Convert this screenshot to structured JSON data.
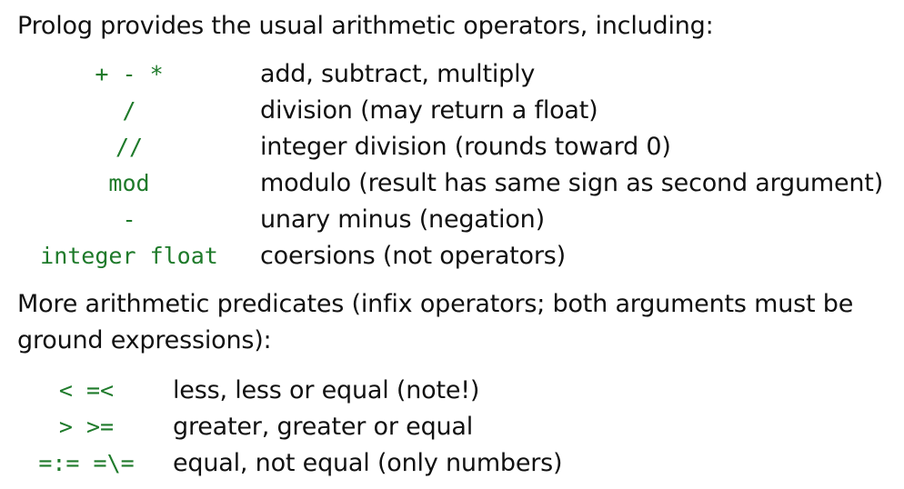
{
  "intro": "Prolog provides the usual arithmetic operators, including:",
  "operators": [
    {
      "symbol": "+ - *",
      "description": "add, subtract, multiply"
    },
    {
      "symbol": "/",
      "description": "division (may return a float)"
    },
    {
      "symbol": "//",
      "description": "integer division (rounds toward 0)"
    },
    {
      "symbol": "mod",
      "description": "modulo (result has same sign as second argument)"
    },
    {
      "symbol": "-",
      "description": "unary minus (negation)"
    },
    {
      "symbol": "integer float",
      "description": "coersions (not operators)"
    }
  ],
  "more_intro_line1": "More arithmetic predicates (infix operators; both arguments must be",
  "more_intro_line2": "ground expressions):",
  "predicates": [
    {
      "symbol": "< =<",
      "description": "less, less or equal (note!)"
    },
    {
      "symbol": "> >=",
      "description": "greater, greater or equal"
    },
    {
      "symbol": "=:= =\\=",
      "description": "equal, not equal (only numbers)"
    }
  ],
  "colors": {
    "code": "#1e7a2a",
    "text": "#111111",
    "background": "#ffffff"
  }
}
